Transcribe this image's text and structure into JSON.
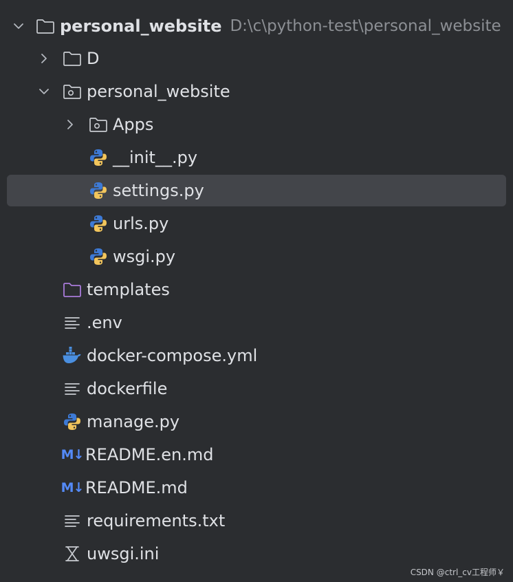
{
  "project": {
    "name": "personal_website",
    "path": "D:\\c\\python-test\\personal_website"
  },
  "items": [
    {
      "label": "D",
      "icon": "folder-icon"
    },
    {
      "label": "personal_website",
      "icon": "package-folder-icon"
    },
    {
      "label": "Apps",
      "icon": "package-folder-icon"
    },
    {
      "label": "__init__.py",
      "icon": "python-file-icon"
    },
    {
      "label": "settings.py",
      "icon": "python-file-icon"
    },
    {
      "label": "urls.py",
      "icon": "python-file-icon"
    },
    {
      "label": "wsgi.py",
      "icon": "python-file-icon"
    },
    {
      "label": "templates",
      "icon": "templates-folder-icon"
    },
    {
      "label": ".env",
      "icon": "text-file-icon"
    },
    {
      "label": "docker-compose.yml",
      "icon": "docker-icon"
    },
    {
      "label": "dockerfile",
      "icon": "text-file-icon"
    },
    {
      "label": "manage.py",
      "icon": "python-file-icon"
    },
    {
      "label": "README.en.md",
      "icon": "markdown-icon"
    },
    {
      "label": "README.md",
      "icon": "markdown-icon"
    },
    {
      "label": "requirements.txt",
      "icon": "text-file-icon"
    },
    {
      "label": "uwsgi.ini",
      "icon": "ini-file-icon"
    }
  ],
  "markdown_icon_text": "M↓",
  "watermark": "CSDN @ctrl_cv工程师￥",
  "colors": {
    "background": "#2b2d30",
    "selected_row": "#43454a",
    "text": "#dfe1e5",
    "path_text": "#8c8f94",
    "python_blue": "#3d7ad6",
    "python_yellow": "#f2c55c",
    "docker_blue": "#4a8fe0",
    "templates_purple": "#a97bd9",
    "markdown_blue": "#548af7"
  }
}
